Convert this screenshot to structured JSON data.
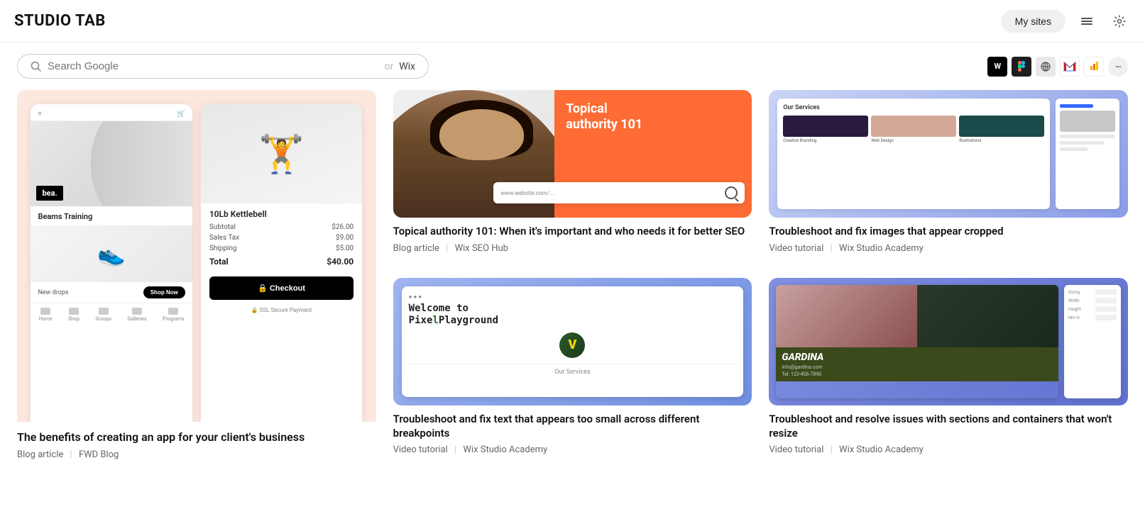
{
  "header": {
    "logo": "STUDIO TAB",
    "my_sites_label": "My sites"
  },
  "search": {
    "placeholder": "Search Google",
    "divider": "or",
    "wix_label": "Wix"
  },
  "extensions": [
    {
      "name": "wix",
      "label": "W"
    },
    {
      "name": "figma",
      "label": "🎨"
    },
    {
      "name": "globe",
      "label": "🌐"
    },
    {
      "name": "gmail",
      "label": "M"
    },
    {
      "name": "analytics",
      "label": "📊"
    },
    {
      "name": "more",
      "label": "···"
    }
  ],
  "cards": [
    {
      "id": "app-benefits",
      "title": "The benefits of creating an app for your client's business",
      "type": "Blog article",
      "source": "FWD Blog",
      "large": true
    },
    {
      "id": "topical-authority",
      "title": "Topical authority 101: When it's important and who needs it for better SEO",
      "type": "Blog article",
      "source": "Wix SEO Hub",
      "thumb_title": "Topical authority 101"
    },
    {
      "id": "troubleshoot-images",
      "title": "Troubleshoot and fix images that appear cropped",
      "type": "Video tutorial",
      "source": "Wix Studio Academy"
    },
    {
      "id": "troubleshoot-text",
      "title": "Troubleshoot and fix text that appears too small across different breakpoints",
      "type": "Video tutorial",
      "source": "Wix Studio Academy"
    },
    {
      "id": "troubleshoot-sections",
      "title": "Troubleshoot and resolve issues with sections and containers that won't resize",
      "type": "Video tutorial",
      "source": "Wix Studio Academy"
    }
  ],
  "mock_ecommerce": {
    "shop_name": "Beams Training",
    "new_drops": "New drops",
    "shop_now": "Shop Now",
    "product_name": "10Lb Kettlebell",
    "subtotal_label": "Subtotal",
    "subtotal_value": "$26.00",
    "tax_label": "Sales Tax",
    "tax_value": "$9.00",
    "shipping_label": "Shipping",
    "shipping_value": "$5.00",
    "total_label": "Total",
    "total_value": "$40.00",
    "checkout_label": "🔒 Checkout",
    "ssl_label": "🔒 SSL Secure Payment"
  },
  "services_card": {
    "title": "Our Services",
    "items": [
      "Creative Branding",
      "Web Design",
      "Illustrations"
    ]
  },
  "topical_card": {
    "title1": "Topical",
    "title2": "authority 101",
    "search_placeholder": "www.website.com/..."
  },
  "pixel_card": {
    "welcome_text": "Welcome to",
    "brand": "Pixel Playground",
    "services_label": "Our Services"
  },
  "gardina_card": {
    "brand": "GARDINA",
    "email": "info@gardina.com",
    "phone": "Tel: 123-456-7890"
  },
  "meta_sep": "|"
}
